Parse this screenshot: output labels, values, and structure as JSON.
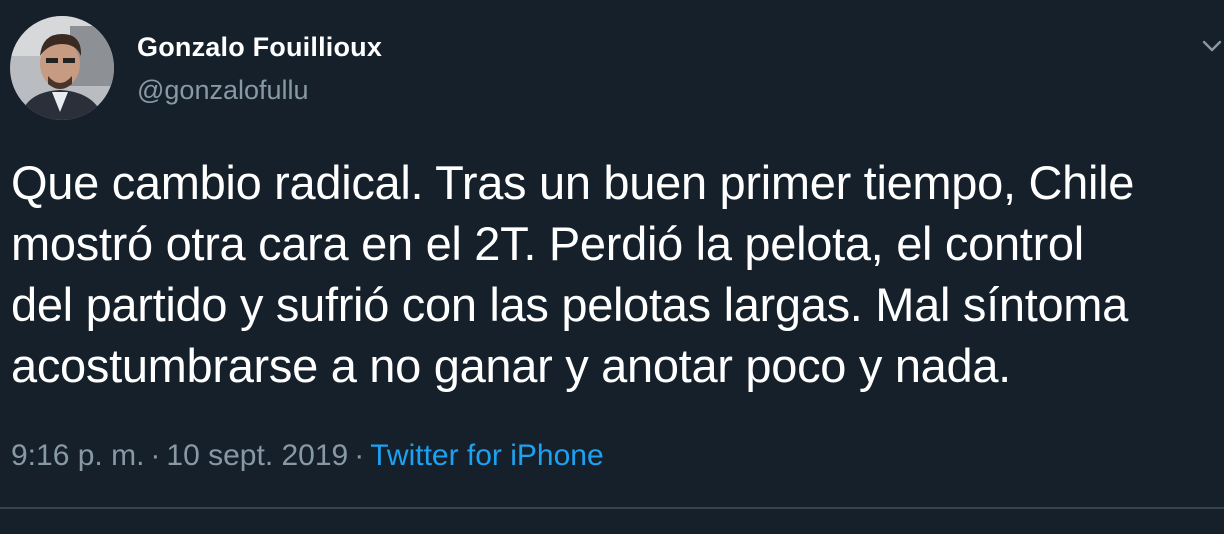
{
  "author": {
    "display_name": "Gonzalo Fouillioux",
    "handle": "@gonzalofullu",
    "avatar_icon": "profile-photo"
  },
  "tweet": {
    "text": "Que cambio radical. Tras un buen primer tiempo, Chile\nmostró otra cara en el 2T. Perdió la pelota, el control\ndel partido y sufrió con las pelotas largas. Mal síntoma\nacostumbrarse a no ganar y anotar poco y nada."
  },
  "meta": {
    "time": "9:16 p. m.",
    "separator": "·",
    "date": "10 sept. 2019",
    "source": "Twitter for iPhone"
  },
  "colors": {
    "background": "#15202b",
    "secondary_text": "#8899a6",
    "link": "#1da1f2",
    "divider": "#38444d"
  },
  "icons": {
    "menu": "chevron-down-icon"
  }
}
